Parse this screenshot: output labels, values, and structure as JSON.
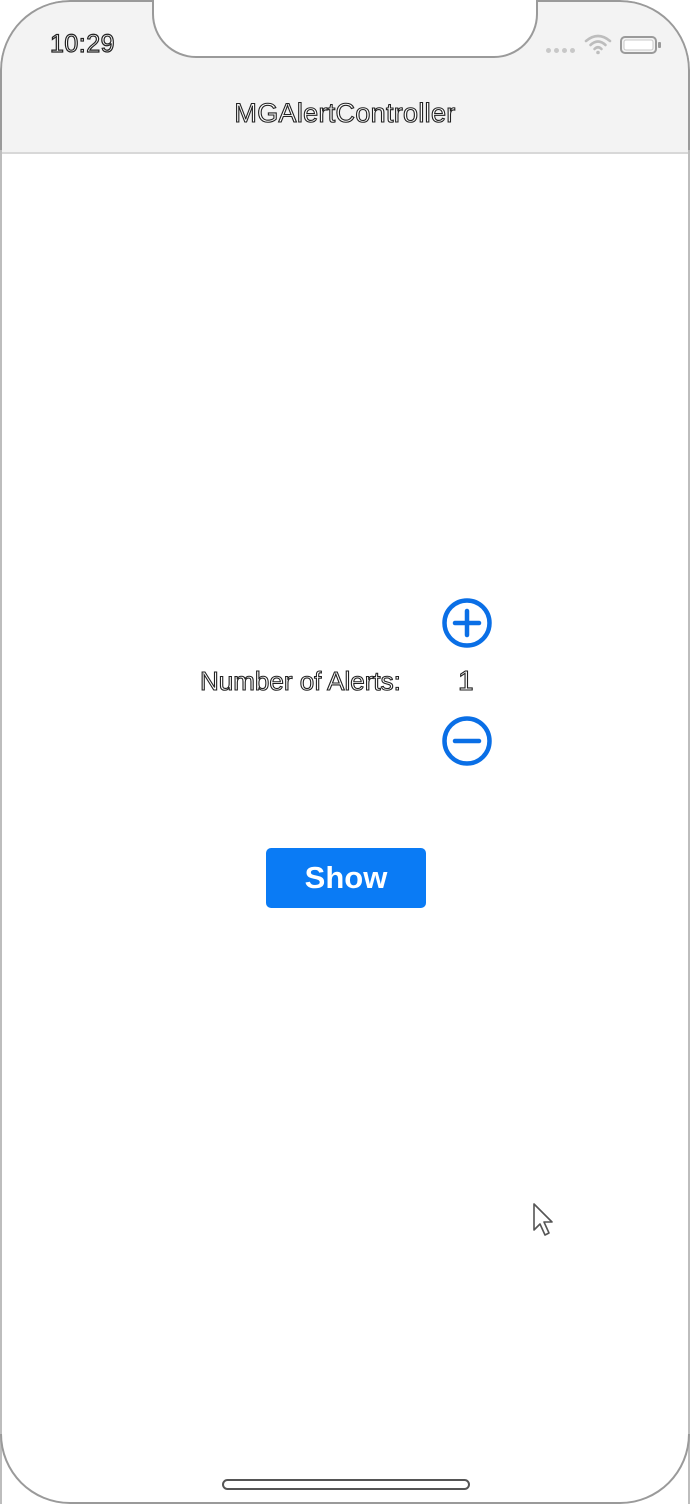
{
  "status_bar": {
    "time": "10:29",
    "wifi_icon": "wifi-icon",
    "battery_icon": "battery-icon"
  },
  "nav": {
    "title": "MGAlertController"
  },
  "alerts": {
    "label": "Number of Alerts:",
    "count": "1",
    "increment_icon": "plus-circle-icon",
    "decrement_icon": "minus-circle-icon"
  },
  "actions": {
    "show_label": "Show"
  },
  "colors": {
    "accent": "#0a7bf5",
    "navbar_bg": "#f3f3f3"
  }
}
